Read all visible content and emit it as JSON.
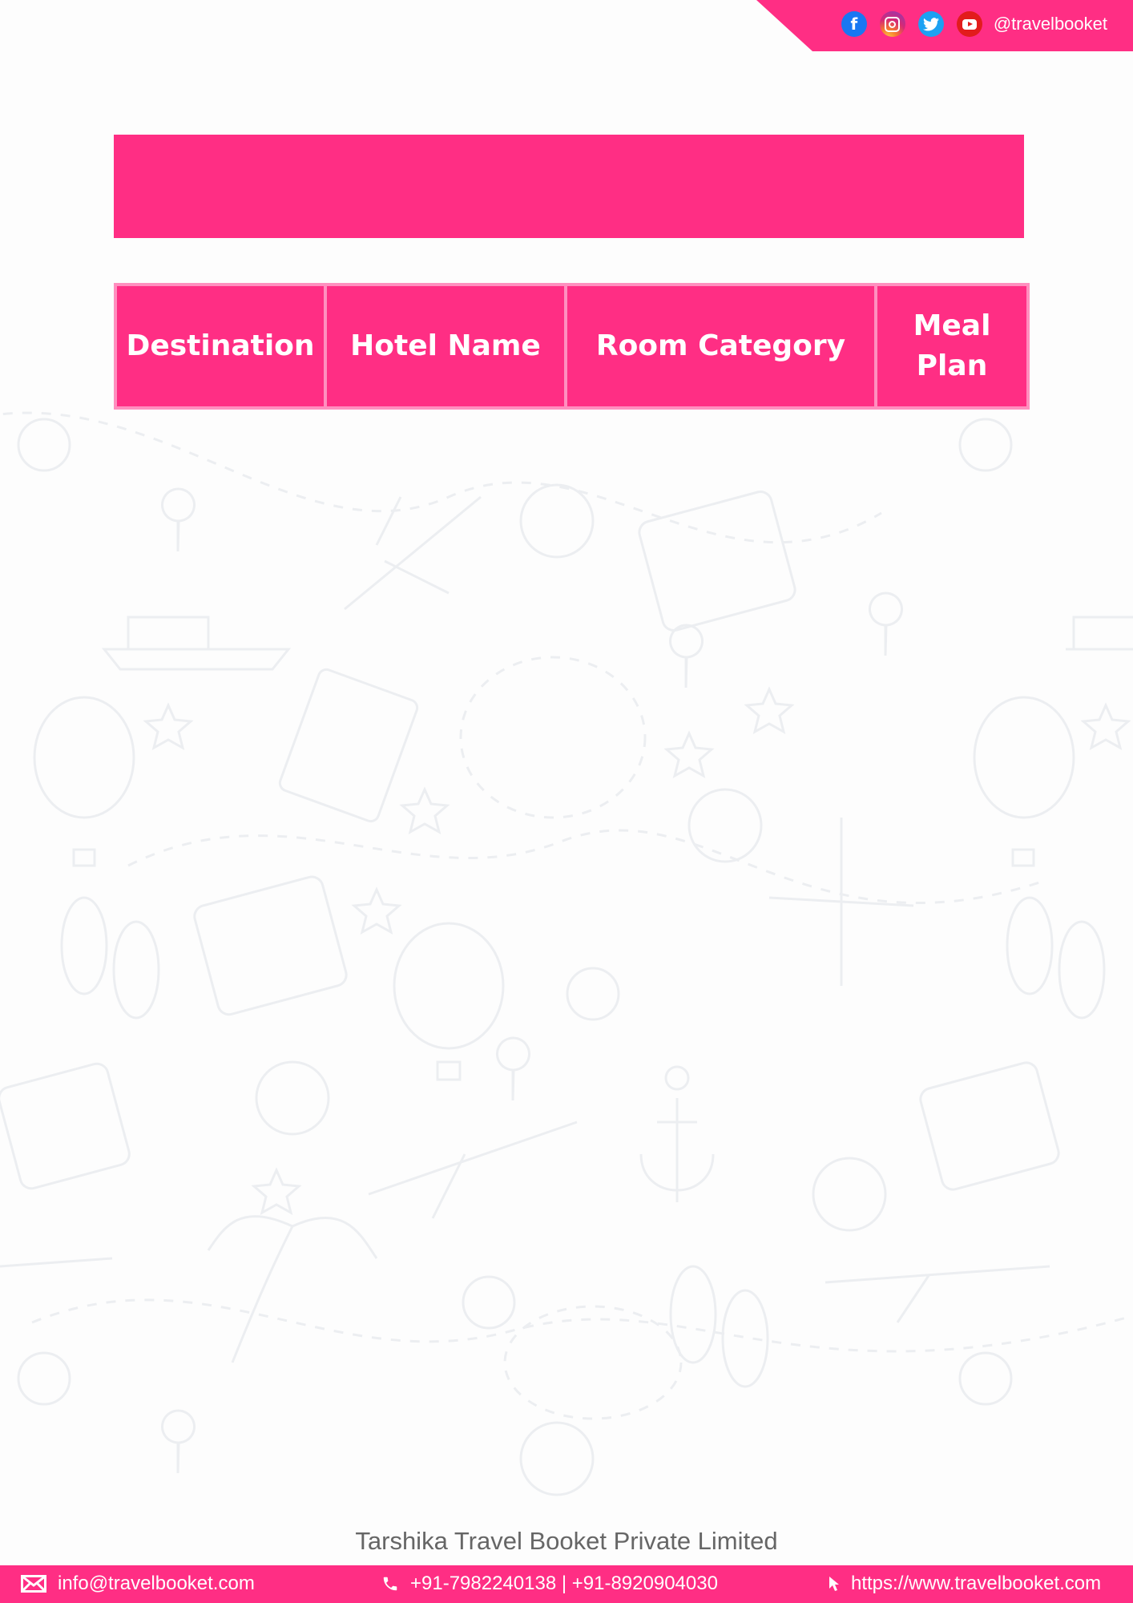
{
  "header": {
    "social_handle": "@travelbooket",
    "social_icons": [
      "facebook-icon",
      "instagram-icon",
      "twitter-icon",
      "youtube-icon"
    ]
  },
  "table": {
    "columns": [
      "Destination",
      "Hotel Name",
      "Room Category",
      "Meal Plan"
    ]
  },
  "footer": {
    "company_name": "Tarshika Travel Booket Private Limited",
    "email": "info@travelbooket.com",
    "phones": "+91-7982240138 | +91-8920904030",
    "website": "https://www.travelbooket.com"
  },
  "colors": {
    "accent": "#ff2e84",
    "table_border": "#ff8fbf"
  }
}
